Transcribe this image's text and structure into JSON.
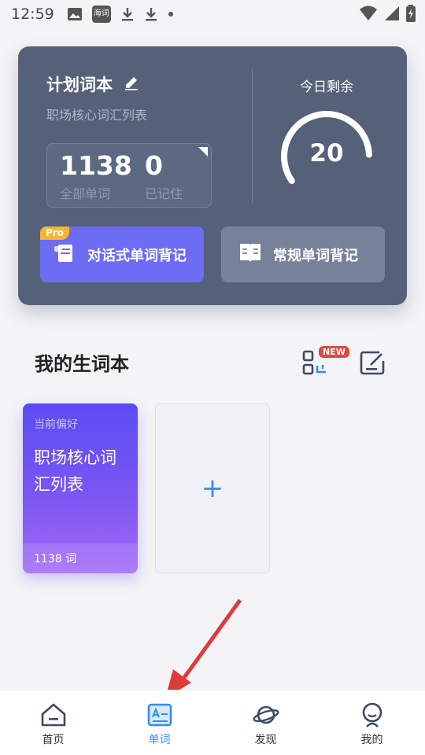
{
  "status_bar": {
    "time": "12:59",
    "notification_icons": [
      "image-icon",
      "app-icon",
      "download-icon",
      "download-icon",
      "dot-icon"
    ],
    "app_icon_text": "海词",
    "right_icons": [
      "wifi-icon",
      "signal-icon",
      "battery-icon"
    ]
  },
  "plan": {
    "title": "计划词本",
    "subtitle": "职场核心词汇列表",
    "total_words": "1138",
    "total_label": "全部单词",
    "remembered": "0",
    "remembered_label": "已记住",
    "today_label": "今日剩余",
    "today_remaining": "20",
    "today_progress": 0.85,
    "dialog_button": "对话式单词背记",
    "pro_badge": "Pro",
    "normal_button": "常规单词背记"
  },
  "wordbook": {
    "section_title": "我的生词本",
    "new_badge": "NEW",
    "books": [
      {
        "preference": "当前偏好",
        "name": "职场核心词汇列表",
        "count": "1138 词"
      }
    ],
    "add_label": "+"
  },
  "nav": {
    "items": [
      {
        "label": "首页",
        "icon": "home-icon"
      },
      {
        "label": "单词",
        "icon": "wordcard-icon",
        "active": true
      },
      {
        "label": "发现",
        "icon": "planet-icon"
      },
      {
        "label": "我的",
        "icon": "profile-icon"
      }
    ]
  },
  "colors": {
    "card_bg": "#556179",
    "primary_button": "#6c6cf5",
    "pro_badge": "#f5b731",
    "active_nav": "#2f8ff0",
    "arrow": "#e03a3a"
  }
}
